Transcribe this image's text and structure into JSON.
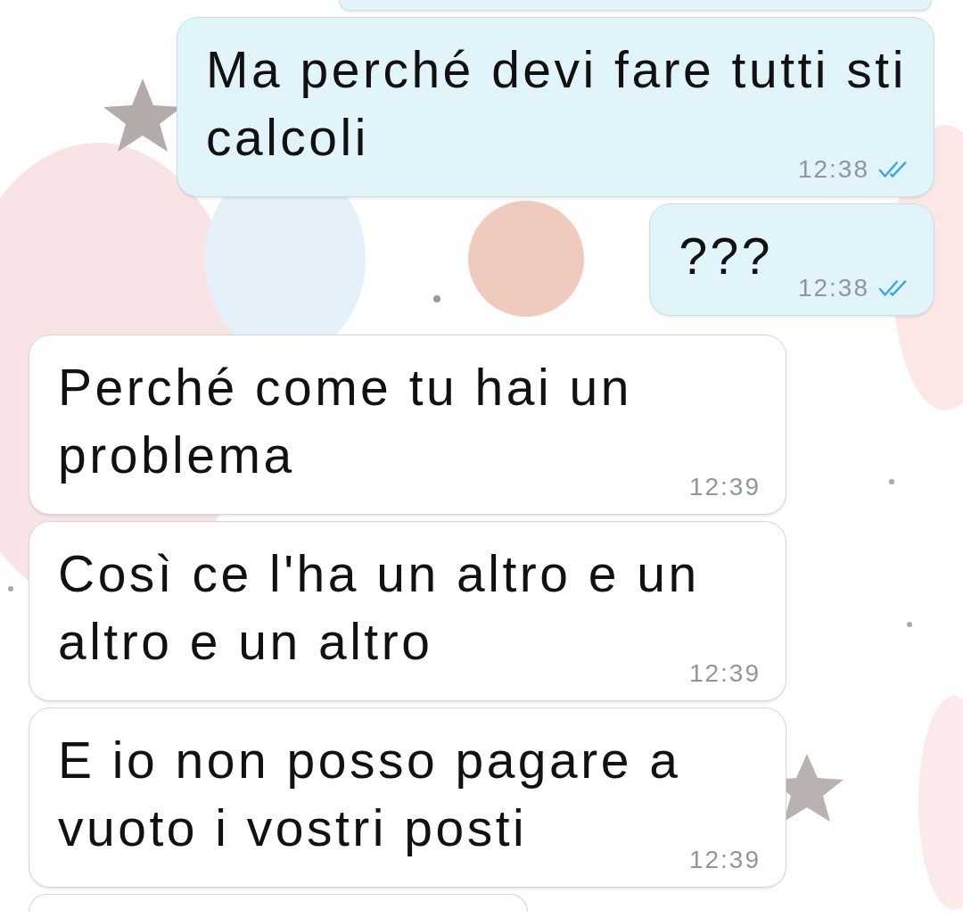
{
  "messages": [
    {
      "kind": "outgoing",
      "cut": true
    },
    {
      "kind": "outgoing",
      "text": "Ma perché devi fare tutti sti calcoli",
      "time": "12:38",
      "read": true
    },
    {
      "kind": "outgoing",
      "text": "???",
      "time": "12:38",
      "read": true
    },
    {
      "kind": "incoming",
      "text": "Perché come tu hai un problema",
      "time": "12:39"
    },
    {
      "kind": "incoming",
      "text": "Così ce l'ha un altro e un altro e un altro",
      "time": "12:39"
    },
    {
      "kind": "incoming",
      "text": "E io non posso pagare a vuoto i vostri posti",
      "time": "12:39"
    },
    {
      "kind": "incoming",
      "cut": true
    }
  ]
}
